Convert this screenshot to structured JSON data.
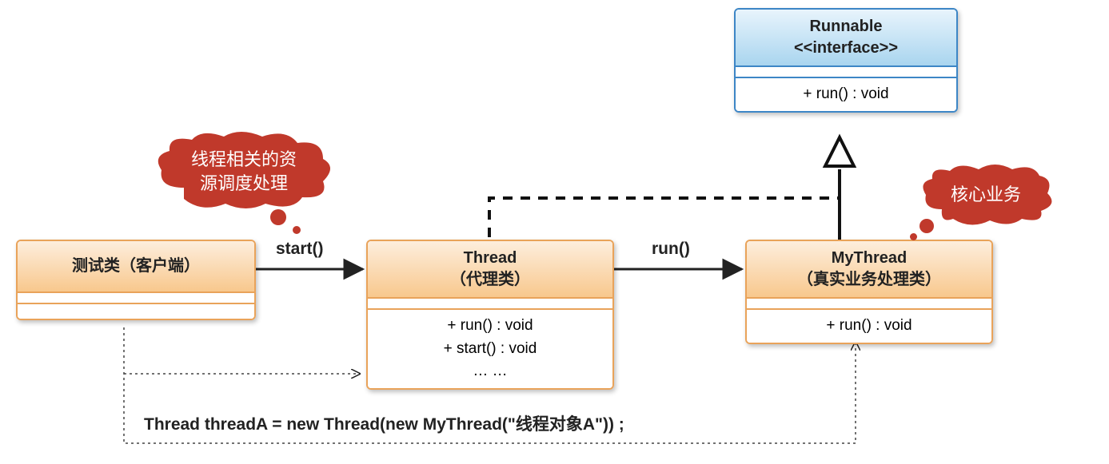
{
  "boxes": {
    "runnable": {
      "title": "Runnable\n<<interface>>",
      "methods": [
        "+ run() : void"
      ]
    },
    "client": {
      "title": "测试类（客户端）"
    },
    "thread": {
      "title": "Thread\n（代理类）",
      "methods": [
        "+ run() : void",
        "+ start() : void",
        "… …"
      ]
    },
    "mythread": {
      "title": "MyThread\n（真实业务处理类）",
      "methods": [
        "+ run() : void"
      ]
    }
  },
  "clouds": {
    "resource": "线程相关的资\n源调度处理",
    "core": "核心业务"
  },
  "edges": {
    "start": "start()",
    "run": "run()"
  },
  "code": "Thread threadA = new Thread(new MyThread(\"线程对象A\")) ;"
}
